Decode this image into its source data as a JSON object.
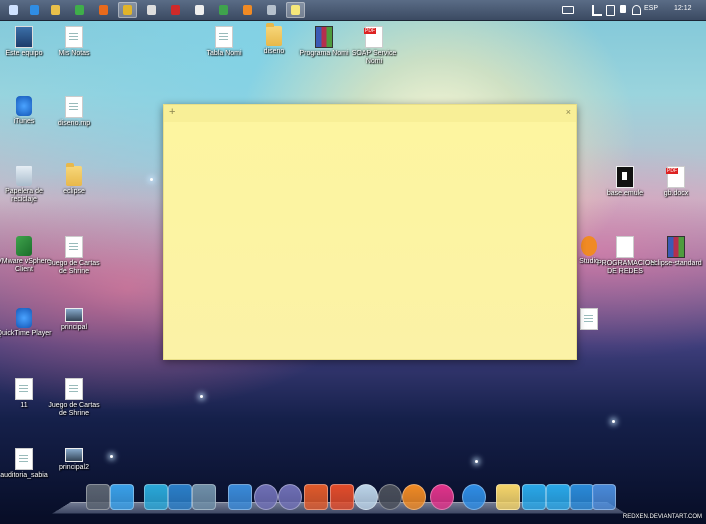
{
  "colors": {
    "taskbar": "#4a5a74",
    "note_yellow": "#fdf6a7",
    "note_bar": "#f8ef97"
  },
  "taskbar": {
    "buttons": [
      {
        "icon": "windows-start-icon",
        "color": "#cfe2ff"
      },
      {
        "icon": "internet-explorer-icon",
        "color": "#2f8de4"
      },
      {
        "icon": "file-explorer-icon",
        "color": "#e8c04a"
      },
      {
        "icon": "evernote-icon",
        "color": "#3fae4a"
      },
      {
        "icon": "firefox-icon",
        "color": "#e86a1c"
      },
      {
        "icon": "chrome-icon",
        "color": "#e0b42a"
      },
      {
        "icon": "calculator-icon",
        "color": "#dddddd"
      },
      {
        "icon": "acrobat-icon",
        "color": "#cf2a2a"
      },
      {
        "icon": "document-icon",
        "color": "#eeeeee"
      },
      {
        "icon": "chrome-icon",
        "color": "#3fa34d"
      },
      {
        "icon": "home-icon",
        "color": "#f08a24"
      },
      {
        "icon": "gear-app-icon",
        "color": "#b5c0cc"
      },
      {
        "icon": "sticky-notes-icon",
        "color": "#f5e77a"
      }
    ],
    "tray": {
      "language": "ESP",
      "clock": "12:12"
    }
  },
  "desktop_icons": [
    {
      "label": "Este equipo",
      "icon": "computer-icon",
      "kind": "monitor"
    },
    {
      "label": "Mis Notas",
      "icon": "document-icon",
      "kind": "doc"
    },
    {
      "label": "iTunes",
      "icon": "itunes-icon",
      "kind": "appblue"
    },
    {
      "label": "diseno.mp",
      "icon": "document-icon",
      "kind": "doc"
    },
    {
      "label": "Papelera de reciclaje",
      "icon": "recycle-bin-icon",
      "kind": "recycle"
    },
    {
      "label": "eclipse",
      "icon": "folder-icon",
      "kind": "folder"
    },
    {
      "label": "VMware vSphere Client",
      "icon": "vmware-icon",
      "kind": "appgreen"
    },
    {
      "label": "Juego de Cartas de Shrine",
      "icon": "document-icon",
      "kind": "doc"
    },
    {
      "label": "QuickTime Player",
      "icon": "quicktime-icon",
      "kind": "appblue"
    },
    {
      "label": "principal",
      "icon": "image-icon",
      "kind": "imgthumb"
    },
    {
      "label": "11",
      "icon": "document-icon",
      "kind": "doc"
    },
    {
      "label": "Juego de Cartas de Shrine",
      "icon": "document-icon",
      "kind": "doc"
    },
    {
      "label": "auditoria_sabia",
      "icon": "document-icon",
      "kind": "doc"
    },
    {
      "label": "principal2",
      "icon": "image-icon",
      "kind": "imgthumb"
    },
    {
      "label": "Tabla Nomi",
      "icon": "document-icon",
      "kind": "doc"
    },
    {
      "label": "diseno",
      "icon": "folder-icon",
      "kind": "folder"
    },
    {
      "label": "Programa Nomi",
      "icon": "winrar-icon",
      "kind": "rar"
    },
    {
      "label": "SOAP Service Nomi",
      "icon": "pdf-icon",
      "kind": "pdf"
    },
    {
      "label": "base.emule",
      "icon": "app-icon",
      "kind": "blackcard"
    },
    {
      "label": "gb.docx",
      "icon": "pdf-icon",
      "kind": "pdf"
    },
    {
      "label": "Studio",
      "icon": "gear-icon",
      "kind": "gear"
    },
    {
      "label": "PROGRAMACION DE REDES",
      "icon": "document-icon",
      "kind": "whitebox"
    },
    {
      "label": "eclipse-standard",
      "icon": "winrar-icon",
      "kind": "rar"
    },
    {
      "label": "",
      "icon": "document-icon",
      "kind": "doc"
    }
  ],
  "sticky_note": {
    "add_glyph": "+",
    "close_glyph": "×",
    "text": ""
  },
  "dock": {
    "items": [
      {
        "icon": "keyboard-icon",
        "color": "#5a6370"
      },
      {
        "icon": "network-icon",
        "color": "#3aa0e8"
      },
      {
        "icon": "photos-icon",
        "color": "#2aa8d8"
      },
      {
        "icon": "mail-icon",
        "color": "#2b7fc8"
      },
      {
        "icon": "package-icon",
        "color": "#6f8fa8"
      },
      {
        "icon": "screenshot-icon",
        "color": "#3a8ad8"
      },
      {
        "icon": "disc-icon",
        "color": "#6f6fb5"
      },
      {
        "icon": "disc-icon",
        "color": "#6f6fb5"
      },
      {
        "icon": "tools-icon",
        "color": "#e05a2a"
      },
      {
        "icon": "git-icon",
        "color": "#e24c2a"
      },
      {
        "icon": "finder-icon",
        "color": "#bcd4e8"
      },
      {
        "icon": "terminal-icon",
        "color": "#4a4f5a"
      },
      {
        "icon": "vlc-icon",
        "color": "#f08a24"
      },
      {
        "icon": "office-icon",
        "color": "#e0338a"
      },
      {
        "icon": "ie-icon",
        "color": "#2f8de4"
      },
      {
        "icon": "notes-icon",
        "color": "#f5d56a"
      },
      {
        "icon": "folder-icon",
        "color": "#2aa8e8"
      },
      {
        "icon": "folder-icon",
        "color": "#2aa8e8"
      },
      {
        "icon": "settings-icon",
        "color": "#2a8ad8"
      },
      {
        "icon": "trash-icon",
        "color": "#4a8ad8"
      }
    ],
    "credit": "REDXEN.DEVIANTART.COM"
  }
}
